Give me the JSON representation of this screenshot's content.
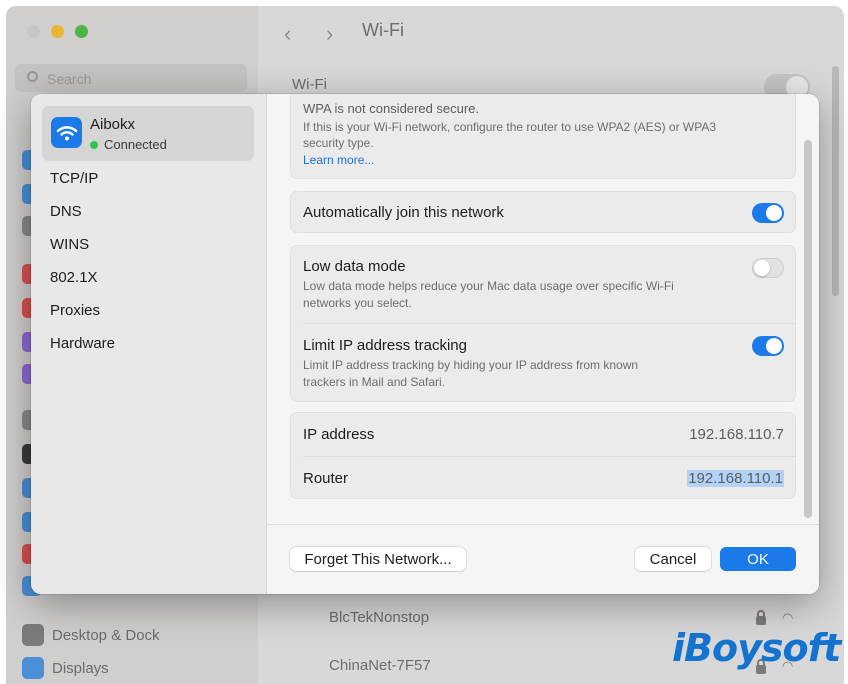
{
  "background": {
    "window_title": "Wi-Fi",
    "search_placeholder": "Search",
    "wifi_label": "Wi-Fi",
    "sidebar_items": [
      {
        "label": "Desktop & Dock",
        "icon": "dock-icon"
      },
      {
        "label": "Displays",
        "icon": "displays-icon"
      }
    ],
    "networks": [
      {
        "name": "BlcTekNonstop",
        "locked": true
      },
      {
        "name": "ChinaNet-7F57",
        "locked": true
      }
    ]
  },
  "dialog": {
    "network": {
      "name": "Aibokx",
      "status": "Connected"
    },
    "nav": [
      "TCP/IP",
      "DNS",
      "WINS",
      "802.1X",
      "Proxies",
      "Hardware"
    ],
    "security_warning": {
      "line1": "WPA is not considered secure.",
      "line2": "If this is your Wi-Fi network, configure the router to use WPA2 (AES) or WPA3",
      "line3": "security type.",
      "link": "Learn more..."
    },
    "auto_join": {
      "label": "Automatically join this network",
      "enabled": true
    },
    "low_data": {
      "label": "Low data mode",
      "desc1": "Low data mode helps reduce your Mac data usage over specific Wi-Fi",
      "desc2": "networks you select.",
      "enabled": false
    },
    "limit_ip": {
      "label": "Limit IP address tracking",
      "desc1": "Limit IP address tracking by hiding your IP address from known",
      "desc2": "trackers in Mail and Safari.",
      "enabled": true
    },
    "ip_address": {
      "label": "IP address",
      "value": "192.168.110.7"
    },
    "router": {
      "label": "Router",
      "value": "192.168.110.1"
    },
    "buttons": {
      "forget": "Forget This Network...",
      "cancel": "Cancel",
      "ok": "OK"
    }
  },
  "watermark": "iBoysoft",
  "colors": {
    "accent": "#1a7ae8",
    "connected": "#31c550",
    "watermark": "#1473cf"
  }
}
